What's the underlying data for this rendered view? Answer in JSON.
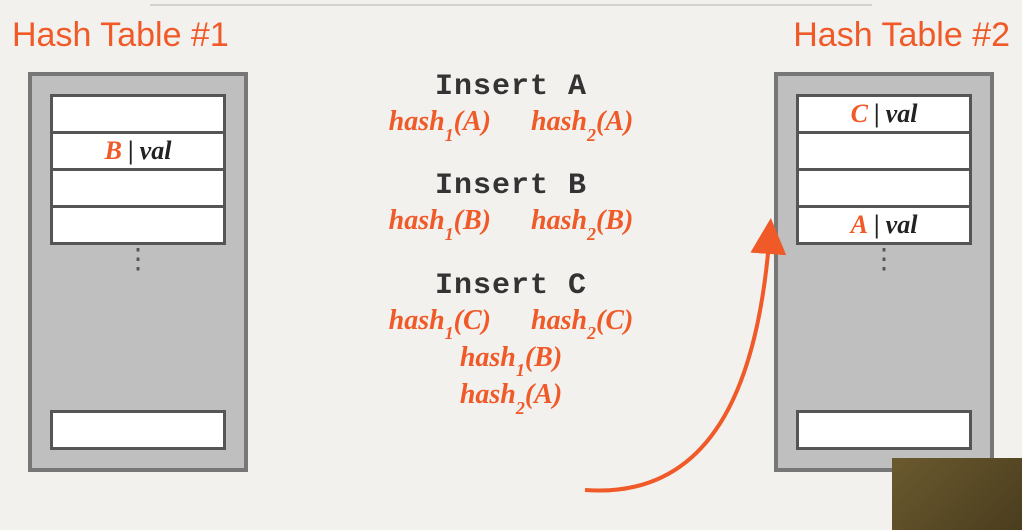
{
  "titles": {
    "left": "Hash Table #1",
    "right": "Hash Table #2"
  },
  "tables": {
    "left": {
      "slots": [
        "",
        "B|val",
        "",
        ""
      ],
      "bottom": ""
    },
    "right": {
      "slots": [
        "C|val",
        "",
        "",
        "A|val"
      ],
      "bottom": ""
    }
  },
  "ops": [
    {
      "title": "Insert A",
      "rows": [
        [
          "hash_1(A)",
          "hash_2(A)"
        ]
      ]
    },
    {
      "title": "Insert B",
      "rows": [
        [
          "hash_1(B)",
          "hash_2(B)"
        ]
      ]
    },
    {
      "title": "Insert C",
      "rows": [
        [
          "hash_1(C)",
          "hash_2(C)"
        ],
        [
          "hash_1(B)"
        ],
        [
          "hash_2(A)"
        ]
      ]
    }
  ],
  "glyphs": {
    "vdots": "⋮"
  },
  "colors": {
    "accent": "#f05a28"
  }
}
